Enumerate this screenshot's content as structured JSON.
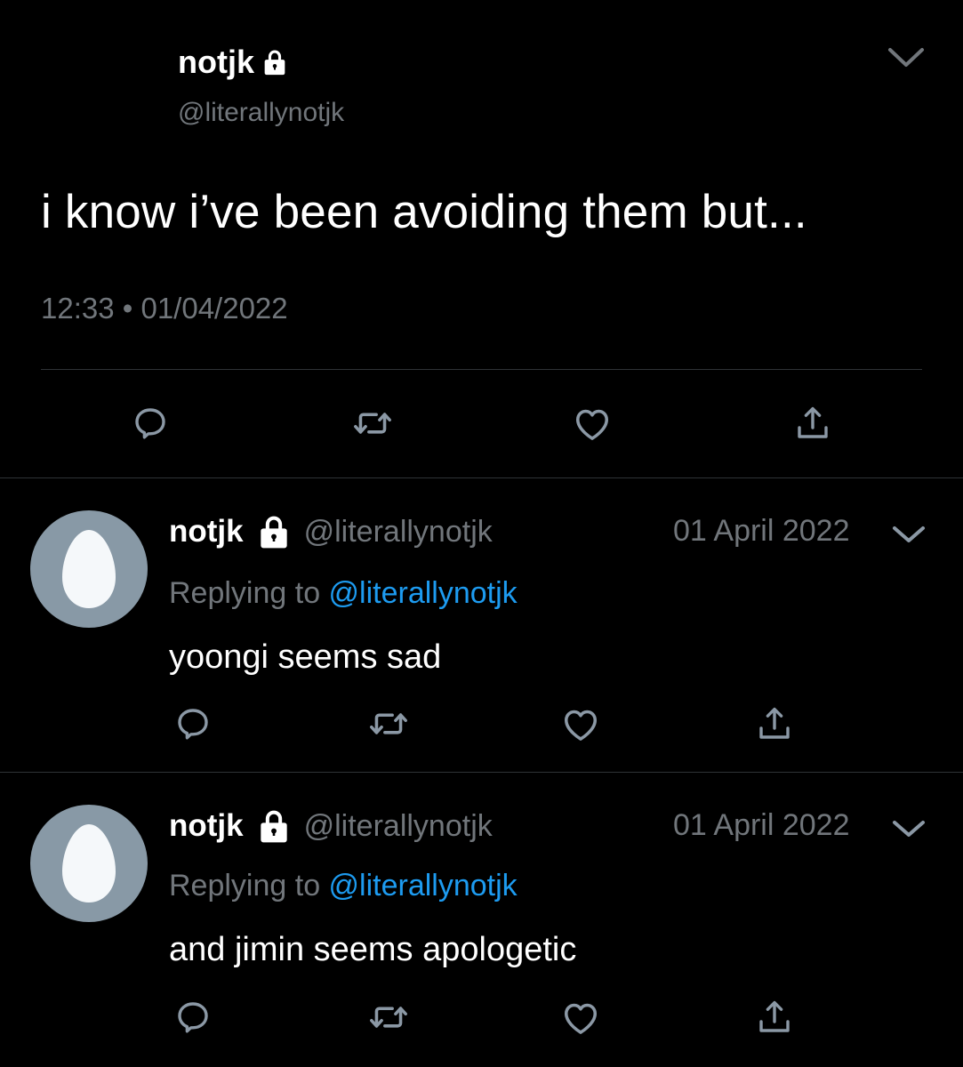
{
  "main_tweet": {
    "display_name": "notjk",
    "handle": "@literallynotjk",
    "text": "i know i’ve been avoiding them but...",
    "timestamp": "12:33 • 01/04/2022"
  },
  "replies": [
    {
      "display_name": "notjk",
      "handle": "@literallynotjk",
      "date": "01 April 2022",
      "replying_prefix": "Replying to ",
      "replying_to": "@literallynotjk",
      "text": "yoongi seems sad"
    },
    {
      "display_name": "notjk",
      "handle": "@literallynotjk",
      "date": "01 April 2022",
      "replying_prefix": "Replying to ",
      "replying_to": "@literallynotjk",
      "text": "and jimin seems apologetic"
    }
  ],
  "icons": {
    "reply": "reply-icon",
    "retweet": "retweet-icon",
    "like": "heart-icon",
    "share": "share-icon",
    "lock": "lock-icon",
    "menu": "chevron-down-icon",
    "avatar": "egg-avatar-icon"
  },
  "colors": {
    "background": "#000000",
    "text_primary": "#ffffff",
    "text_secondary": "#71767b",
    "link": "#1d9bf0",
    "divider": "#2f3336",
    "avatar_bg": "#8899a6",
    "avatar_egg": "#f5f8fa"
  }
}
